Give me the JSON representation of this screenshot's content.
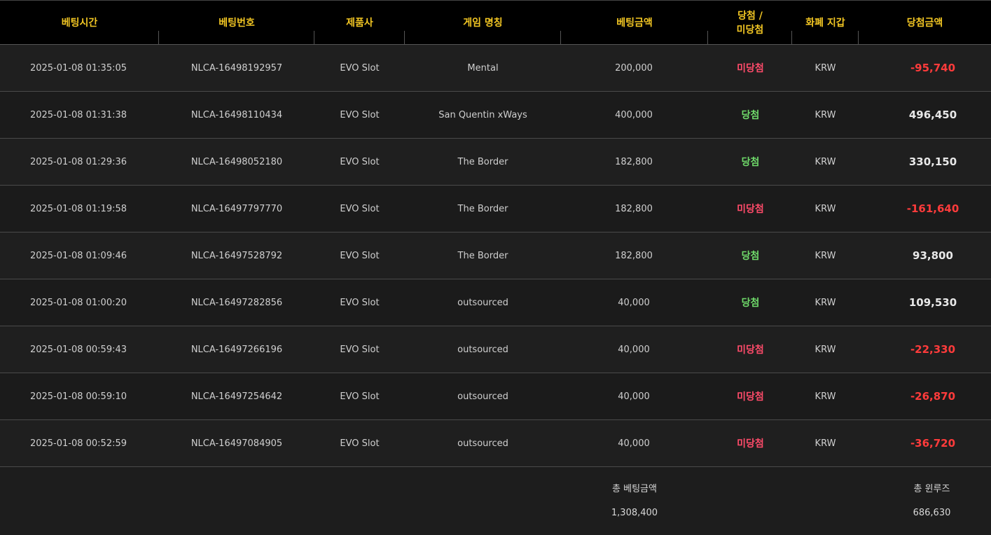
{
  "headers": {
    "bet_time": "베팅시간",
    "bet_no": "베팅번호",
    "provider": "제품사",
    "game_name": "게임 명칭",
    "bet_amount": "베팅금액",
    "result_line1": "당첨 /",
    "result_line2": "미당첨",
    "wallet": "화폐 지갑",
    "win_amount": "당첨금액"
  },
  "rows": [
    {
      "time": "2025-01-08 01:35:05",
      "bet_no": "NLCA-16498192957",
      "provider": "EVO Slot",
      "game": "Mental",
      "bet": "200,000",
      "result": "미당첨",
      "wallet": "KRW",
      "win": "-95,740"
    },
    {
      "time": "2025-01-08 01:31:38",
      "bet_no": "NLCA-16498110434",
      "provider": "EVO Slot",
      "game": "San Quentin xWays",
      "bet": "400,000",
      "result": "당첨",
      "wallet": "KRW",
      "win": "496,450"
    },
    {
      "time": "2025-01-08 01:29:36",
      "bet_no": "NLCA-16498052180",
      "provider": "EVO Slot",
      "game": "The Border",
      "bet": "182,800",
      "result": "당첨",
      "wallet": "KRW",
      "win": "330,150"
    },
    {
      "time": "2025-01-08 01:19:58",
      "bet_no": "NLCA-16497797770",
      "provider": "EVO Slot",
      "game": "The Border",
      "bet": "182,800",
      "result": "미당첨",
      "wallet": "KRW",
      "win": "-161,640"
    },
    {
      "time": "2025-01-08 01:09:46",
      "bet_no": "NLCA-16497528792",
      "provider": "EVO Slot",
      "game": "The Border",
      "bet": "182,800",
      "result": "당첨",
      "wallet": "KRW",
      "win": "93,800"
    },
    {
      "time": "2025-01-08 01:00:20",
      "bet_no": "NLCA-16497282856",
      "provider": "EVO Slot",
      "game": "outsourced",
      "bet": "40,000",
      "result": "당첨",
      "wallet": "KRW",
      "win": "109,530"
    },
    {
      "time": "2025-01-08 00:59:43",
      "bet_no": "NLCA-16497266196",
      "provider": "EVO Slot",
      "game": "outsourced",
      "bet": "40,000",
      "result": "미당첨",
      "wallet": "KRW",
      "win": "-22,330"
    },
    {
      "time": "2025-01-08 00:59:10",
      "bet_no": "NLCA-16497254642",
      "provider": "EVO Slot",
      "game": "outsourced",
      "bet": "40,000",
      "result": "미당첨",
      "wallet": "KRW",
      "win": "-26,870"
    },
    {
      "time": "2025-01-08 00:52:59",
      "bet_no": "NLCA-16497084905",
      "provider": "EVO Slot",
      "game": "outsourced",
      "bet": "40,000",
      "result": "미당첨",
      "wallet": "KRW",
      "win": "-36,720"
    }
  ],
  "footer": {
    "total_bet_label": "총 베팅금액",
    "total_bet_value": "1,308,400",
    "total_winloss_label": "총 윈루즈",
    "total_winloss_value": "686,630"
  },
  "colors": {
    "header_text": "#f2c623",
    "win_text": "#6fd96a",
    "lose_text": "#ff4b6a",
    "negative_amount": "#ff3b3b"
  }
}
